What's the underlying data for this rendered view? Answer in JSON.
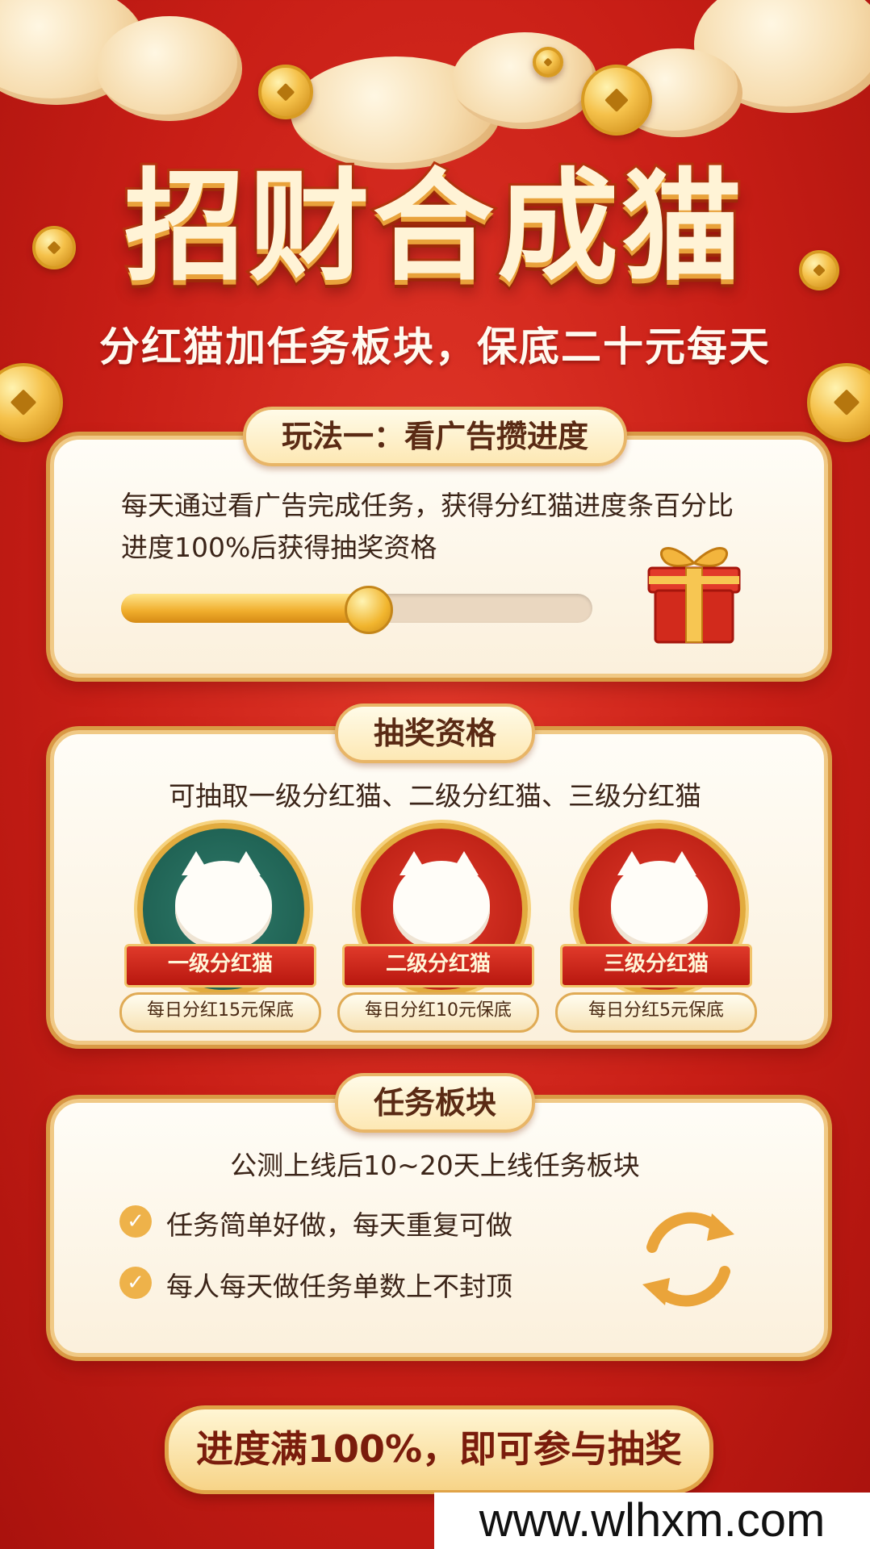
{
  "header": {
    "title": "招财合成猫",
    "subtitle": "分红猫加任务板块，保底二十元每天"
  },
  "section1": {
    "tag": "玩法一：看广告攒进度",
    "line1": "每天通过看广告完成任务，获得分红猫进度条百分比",
    "line2": "进度100%后获得抽奖资格",
    "progress_fraction": 0.52
  },
  "section2": {
    "tag": "抽奖资格",
    "desc": "可抽取一级分红猫、二级分红猫、三级分红猫",
    "badges": [
      {
        "name": "一级分红猫",
        "note": "每日分红15元保底"
      },
      {
        "name": "二级分红猫",
        "note": "每日分红10元保底"
      },
      {
        "name": "三级分红猫",
        "note": "每日分红5元保底"
      }
    ]
  },
  "section3": {
    "tag": "任务板块",
    "desc": "公测上线后10~20天上线任务板块",
    "items": [
      "任务简单好做，每天重复可做",
      "每人每天做任务单数上不封顶"
    ]
  },
  "cta": "进度满100%，即可参与抽奖",
  "watermark": "www.wlhxm.com",
  "colors": {
    "background": "#c81e16",
    "gold": "#f0b23a",
    "panel": "#fdf6e8"
  },
  "icons": [
    "gift-icon",
    "refresh-cycle-icon",
    "check-icon",
    "coin-icon",
    "cloud-decoration"
  ]
}
